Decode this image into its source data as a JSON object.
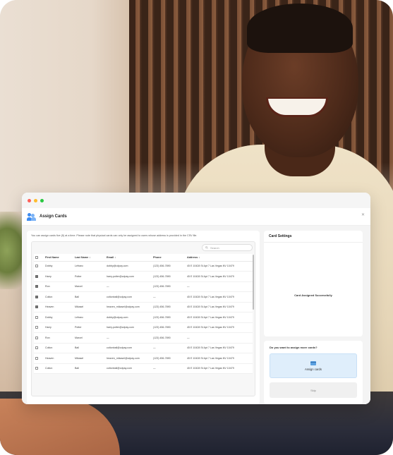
{
  "modal": {
    "title": "Assign Cards",
    "close_icon": "close-icon",
    "title_icon": "users-icon"
  },
  "info_text": "You can assign cards five (5) at a time. Please note that physical cards can only be assigned to users whose address is provided in the CSV file.",
  "search": {
    "placeholder": "Search"
  },
  "table": {
    "columns": [
      "First Name",
      "Last Name",
      "Email",
      "Phone",
      "Address"
    ],
    "rows": [
      {
        "checked": false,
        "first": "Dobby",
        "last": "Lefranc",
        "email": "dobby@cdpay.com",
        "phone": "(123) 456-7890",
        "address": "45 E 10428 St Apt 7 Las Vegas NV 10479"
      },
      {
        "checked": true,
        "first": "Harry",
        "last": "Potter",
        "email": "harry.potter@cdpay.com",
        "phone": "(123) 456-7890",
        "address": "45 E 10428 St Apt 7 Las Vegas NV 10479"
      },
      {
        "checked": true,
        "first": "Ron",
        "last": "Marcel",
        "email": "—",
        "phone": "(123) 456-7890",
        "address": "—"
      },
      {
        "checked": true,
        "first": "Colton",
        "last": "Ball",
        "email": "coltonball@cdpay.com",
        "phone": "—",
        "address": "45 E 10428 St Apt 7 Las Vegas NV 10479"
      },
      {
        "checked": true,
        "first": "Heaven",
        "last": "Mikasel",
        "email": "heaven_mikasel@cdpay.com",
        "phone": "(123) 456-7890",
        "address": "45 E 10428 St Apt 7 Las Vegas NV 10479"
      },
      {
        "checked": false,
        "first": "Dobby",
        "last": "Lefranc",
        "email": "dobby@cdpay.com",
        "phone": "(123) 456-7890",
        "address": "45 E 10428 St Apt 7 Las Vegas NV 10479"
      },
      {
        "checked": false,
        "first": "Harry",
        "last": "Potter",
        "email": "harry.potter@cdpay.com",
        "phone": "(123) 456-7890",
        "address": "45 E 10428 St Apt 7 Las Vegas NV 10479"
      },
      {
        "checked": false,
        "first": "Ron",
        "last": "Marcel",
        "email": "—",
        "phone": "(123) 456-7890",
        "address": "—"
      },
      {
        "checked": false,
        "first": "Colton",
        "last": "Ball",
        "email": "coltonball@cdpay.com",
        "phone": "—",
        "address": "45 E 10428 St Apt 7 Las Vegas NV 10479"
      },
      {
        "checked": false,
        "first": "Heaven",
        "last": "Mikasel",
        "email": "heaven_mikasel@cdpay.com",
        "phone": "(123) 456-7890",
        "address": "45 E 10428 St Apt 7 Las Vegas NV 10479"
      },
      {
        "checked": false,
        "first": "Colton",
        "last": "Ball",
        "email": "coltonball@cdpay.com",
        "phone": "—",
        "address": "45 E 10428 St Apt 7 Las Vegas NV 10479"
      }
    ]
  },
  "card_settings": {
    "title": "Card Settings",
    "message": "Card Assigned Successfully"
  },
  "more": {
    "question": "Do you want to assign more cards?",
    "assign_label": "Assign cards",
    "skip_label": "Skip"
  },
  "colors": {
    "accent": "#3d8bf0",
    "assign_bg": "#dfeefb",
    "window_bg": "#ffffff"
  }
}
